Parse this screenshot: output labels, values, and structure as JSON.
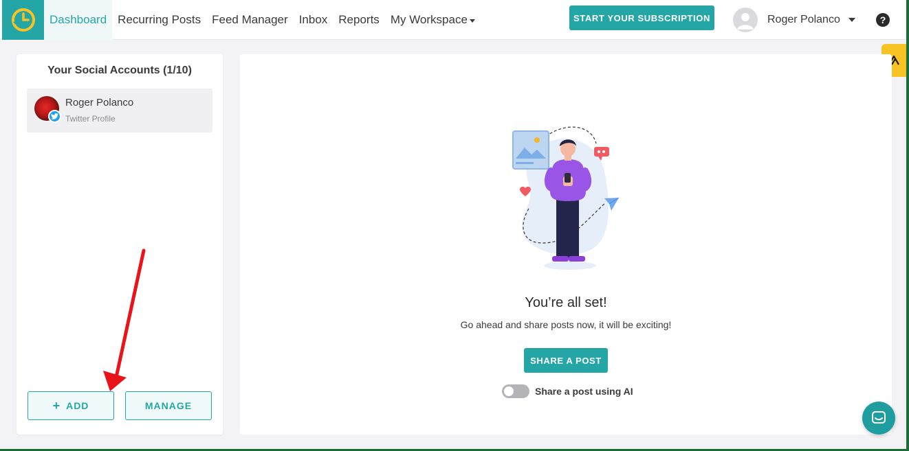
{
  "nav": {
    "items": [
      {
        "label": "Dashboard",
        "active": true
      },
      {
        "label": "Recurring Posts"
      },
      {
        "label": "Feed Manager"
      },
      {
        "label": "Inbox"
      },
      {
        "label": "Reports"
      },
      {
        "label": "My Workspace"
      }
    ],
    "subscribe_label": "START YOUR SUBSCRIPTION",
    "user_name": "Roger Polanco",
    "help_glyph": "?"
  },
  "accounts": {
    "title": "Your Social Accounts (1/10)",
    "items": [
      {
        "name": "Roger Polanco",
        "type": "Twitter Profile",
        "network_icon": "twitter-icon"
      }
    ],
    "add_label": "ADD",
    "manage_label": "MANAGE"
  },
  "main": {
    "title": "You’re all set!",
    "subtitle": "Go ahead and share posts now, it will be exciting!",
    "share_label": "SHARE A POST",
    "ai_toggle_label": "Share a post using AI",
    "ai_toggle_on": false
  },
  "colors": {
    "accent": "#24a6a6",
    "twitter": "#1da1f2",
    "side_tab": "#f7c325",
    "annotation_arrow": "#e8141a"
  }
}
